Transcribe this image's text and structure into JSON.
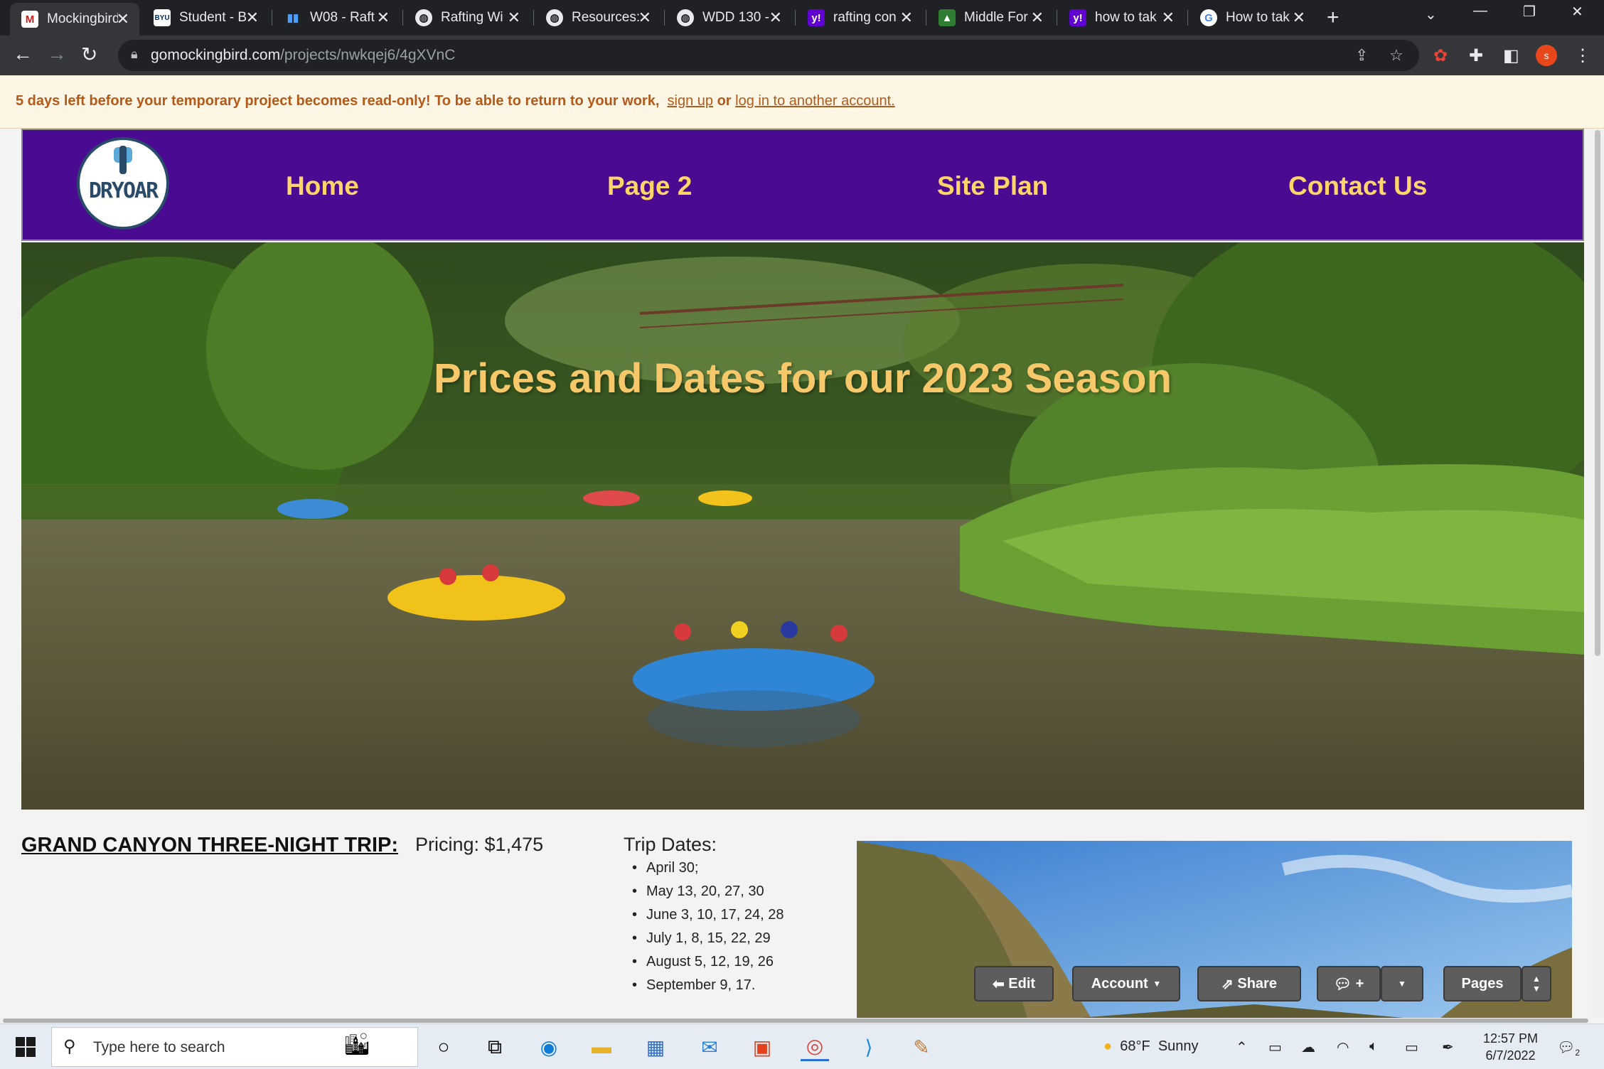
{
  "browser": {
    "tabs": [
      {
        "title": "Mockingbird",
        "favicon": "mockingbird-m-icon",
        "active": true
      },
      {
        "title": "Student - B",
        "favicon": "byu-icon"
      },
      {
        "title": "W08 - Raft",
        "favicon": "audio-bars-icon"
      },
      {
        "title": "Rafting Wi",
        "favicon": "globe-icon"
      },
      {
        "title": "Resources:",
        "favicon": "globe-icon"
      },
      {
        "title": "WDD 130 -",
        "favicon": "globe-icon"
      },
      {
        "title": "rafting con",
        "favicon": "yahoo-icon"
      },
      {
        "title": "Middle For",
        "favicon": "tree-icon"
      },
      {
        "title": "how to tak",
        "favicon": "yahoo-icon"
      },
      {
        "title": "How to tak",
        "favicon": "google-docs-icon"
      }
    ],
    "url_host": "gomockingbird.com",
    "url_path": "/projects/nwkqej6/4gXVnC",
    "profile_initial": "s"
  },
  "notice": {
    "message": "5 days left before your temporary project becomes read-only! To be able to return to your work,",
    "signup_link": "sign up",
    "or_text": "or",
    "login_link": "log in to another account."
  },
  "site": {
    "logo_text": "DRYOAR",
    "nav": [
      "Home",
      "Page 2",
      "Site Plan",
      "Contact Us"
    ],
    "hero_title": "Prices and Dates for our 2023 Season",
    "trip": {
      "heading": "GRAND CANYON THREE-NIGHT TRIP:",
      "pricing": "Pricing: $1,475",
      "dates_title": "Trip Dates:",
      "dates": [
        "April 30;",
        "May 13, 20, 27, 30",
        "June 3, 10, 17, 24, 28",
        "July 1, 8, 15, 22, 29",
        "August 5, 12, 19, 26",
        "September 9, 17."
      ]
    }
  },
  "mockingbird_toolbar": {
    "edit": "Edit",
    "account": "Account",
    "share": "Share",
    "comment": "+",
    "pages": "Pages"
  },
  "taskbar": {
    "search_placeholder": "Type here to search",
    "weather_temp": "68°F",
    "weather_text": "Sunny",
    "time": "12:57 PM",
    "date": "6/7/2022",
    "notification_count": "2"
  },
  "colors": {
    "nav_bg": "#4a0a91",
    "nav_text": "#ffd56a",
    "notice_text": "#b35a1a",
    "notice_bg": "#fdf6e4"
  }
}
